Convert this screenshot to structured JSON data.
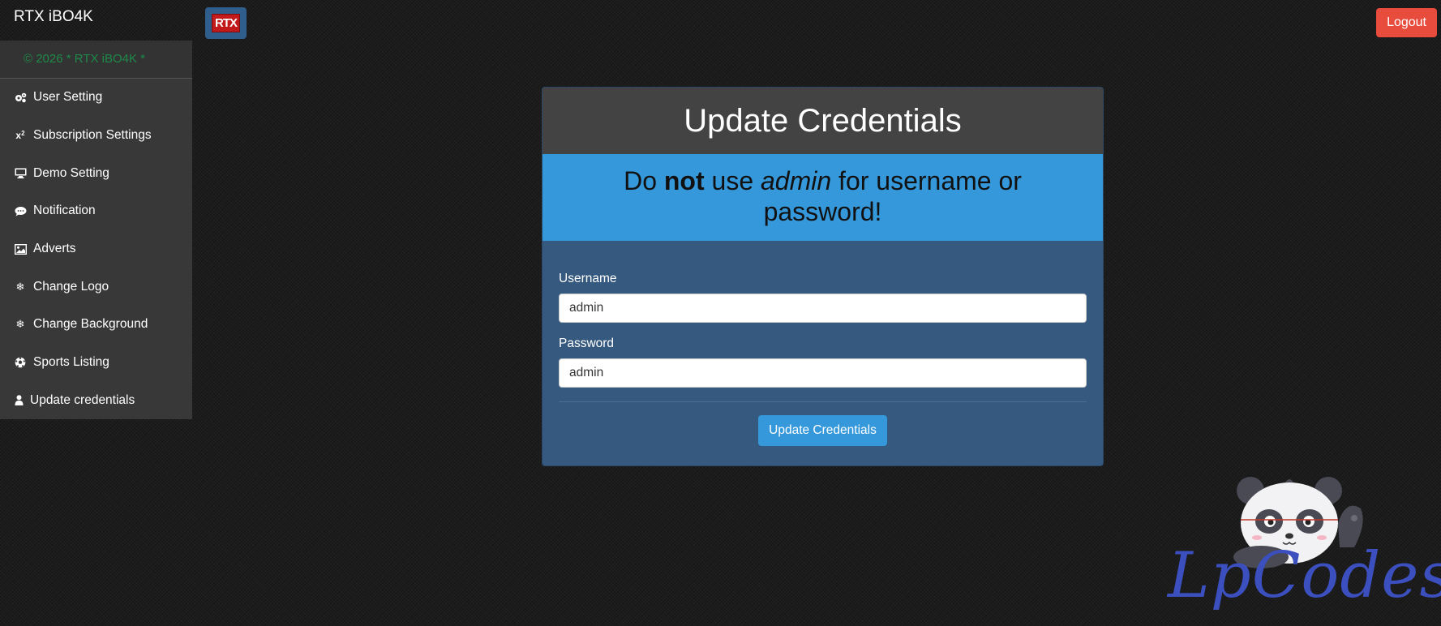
{
  "header": {
    "brand": "RTX iBO4K",
    "logo_badge": "RTX",
    "logout_label": "Logout"
  },
  "sidebar": {
    "copyright": "© 2026 * RTX iBO4K *",
    "items": [
      {
        "label": "User Setting",
        "icon": "gears-icon"
      },
      {
        "label": "Subscription Settings",
        "icon": "subscript-icon"
      },
      {
        "label": "Demo Setting",
        "icon": "monitor-icon"
      },
      {
        "label": "Notification",
        "icon": "chat-bubble-icon"
      },
      {
        "label": "Adverts",
        "icon": "image-icon"
      },
      {
        "label": "Change Logo",
        "icon": "snowflake-icon"
      },
      {
        "label": "Change Background",
        "icon": "snowflake-icon"
      },
      {
        "label": "Sports Listing",
        "icon": "soccer-ball-icon"
      },
      {
        "label": "Update credentials",
        "icon": "user-icon"
      }
    ]
  },
  "card": {
    "title": "Update Credentials",
    "alert": {
      "pre": "Do ",
      "bold": "not",
      "mid": " use ",
      "italic": "admin",
      "post": " for username or password!"
    },
    "username_label": "Username",
    "username_value": "admin",
    "password_label": "Password",
    "password_value": "admin",
    "submit_label": "Update Credentials"
  },
  "watermark": {
    "text": "LpCodes"
  },
  "colors": {
    "sidebar_bg": "#383838",
    "card_bg": "#365a7f",
    "alert_bg": "#3498db",
    "logout_bg": "#e74c3c",
    "copyright_text": "#1e8a4a"
  }
}
